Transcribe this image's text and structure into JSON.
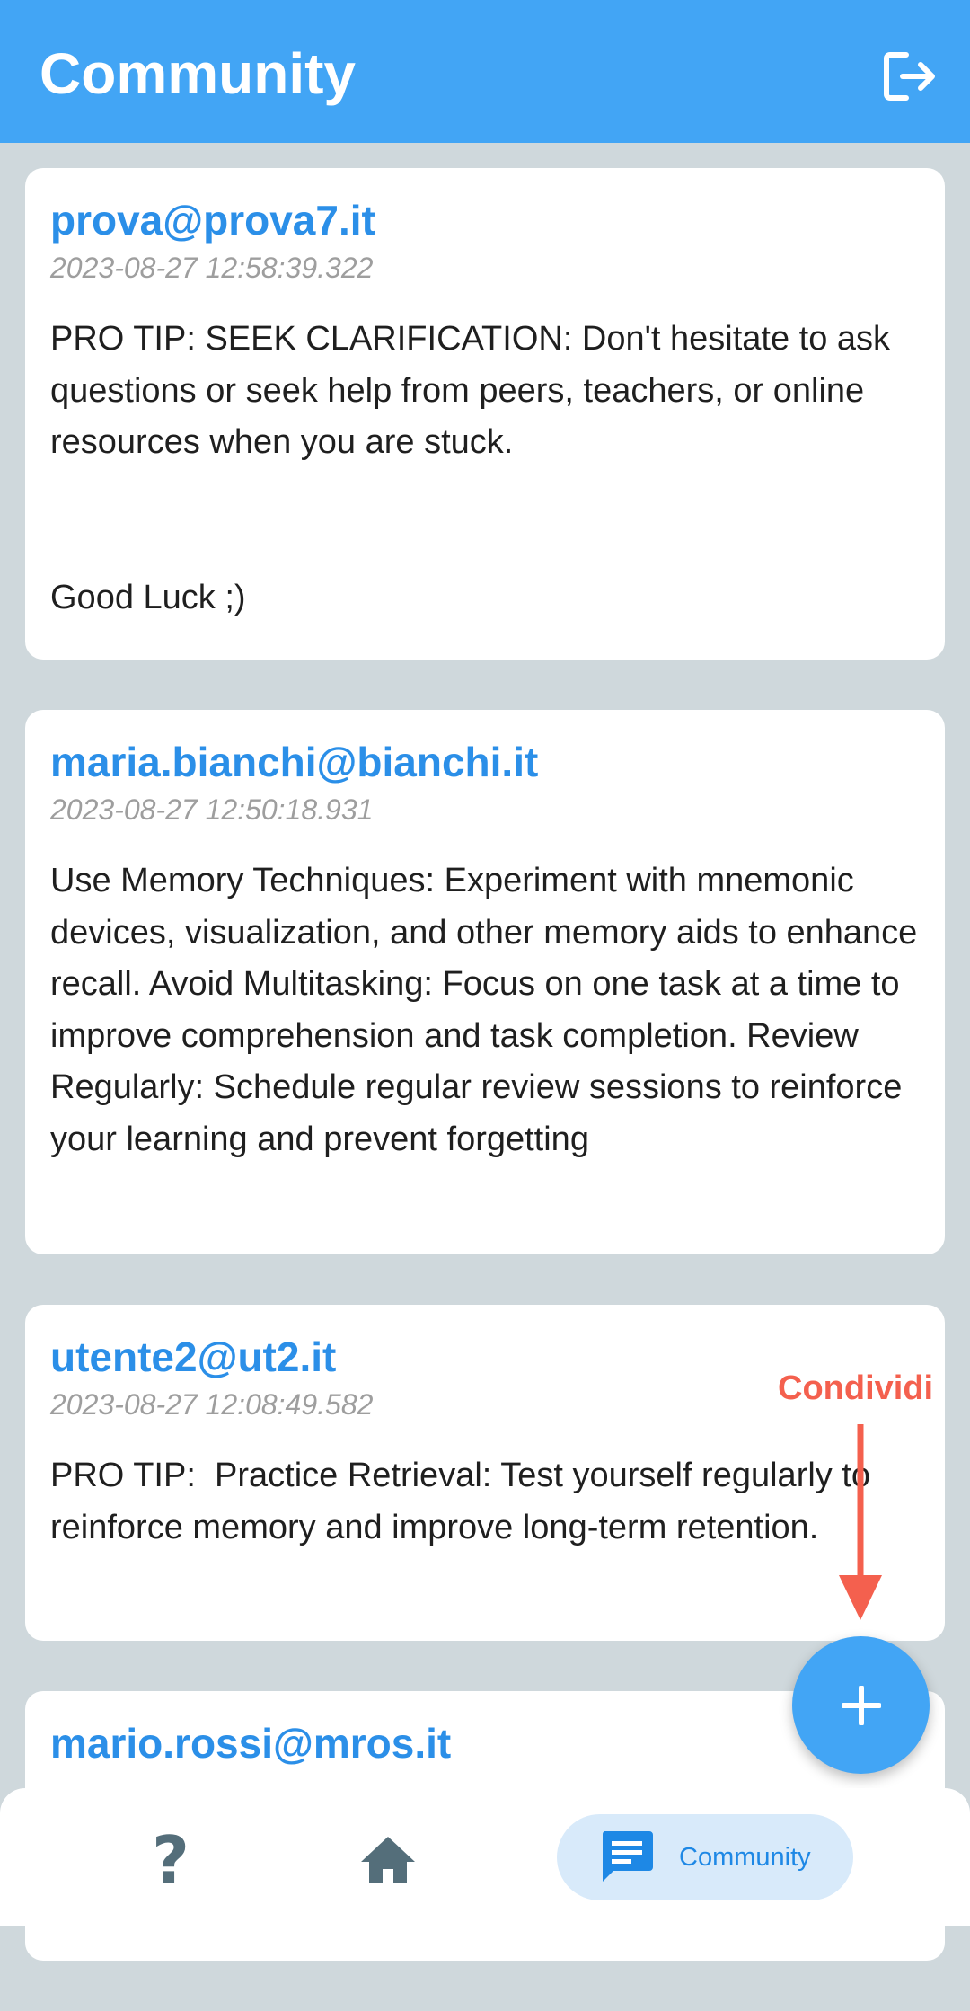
{
  "app_bar": {
    "title": "Community",
    "logout_icon": "logout-icon"
  },
  "colors": {
    "app_bar": "#42a5f5",
    "background": "#cfd8dc",
    "author": "#2b8fe8",
    "annotation": "#f4604e"
  },
  "posts": [
    {
      "author": "prova@prova7.it",
      "timestamp": "2023-08-27 12:58:39.322",
      "body": "PRO TIP: SEEK CLARIFICATION: Don't hesitate to ask questions or seek help from peers, teachers, or online resources when you are stuck.\n\n\nGood Luck ;)"
    },
    {
      "author": "maria.bianchi@bianchi.it",
      "timestamp": "2023-08-27 12:50:18.931",
      "body": "Use Memory Techniques: Experiment with mnemonic devices, visualization, and other memory aids to enhance recall. Avoid Multitasking: Focus on one task at a time to improve comprehension and task completion. Review Regularly: Schedule regular review sessions to reinforce your learning and prevent forgetting"
    },
    {
      "author": "utente2@ut2.it",
      "timestamp": "2023-08-27 12:08:49.582",
      "body": "PRO TIP:  Practice Retrieval: Test yourself regularly to reinforce memory and improve long-term retention."
    },
    {
      "author": "mario.rossi@mros.it",
      "timestamp": "",
      "body": ""
    }
  ],
  "annotation": {
    "label": "Condividi"
  },
  "fab": {
    "icon": "plus-icon"
  },
  "bottom_nav": {
    "items": [
      {
        "icon": "help-icon",
        "label": ""
      },
      {
        "icon": "home-icon",
        "label": ""
      },
      {
        "icon": "chat-icon",
        "label": "Community"
      }
    ]
  }
}
